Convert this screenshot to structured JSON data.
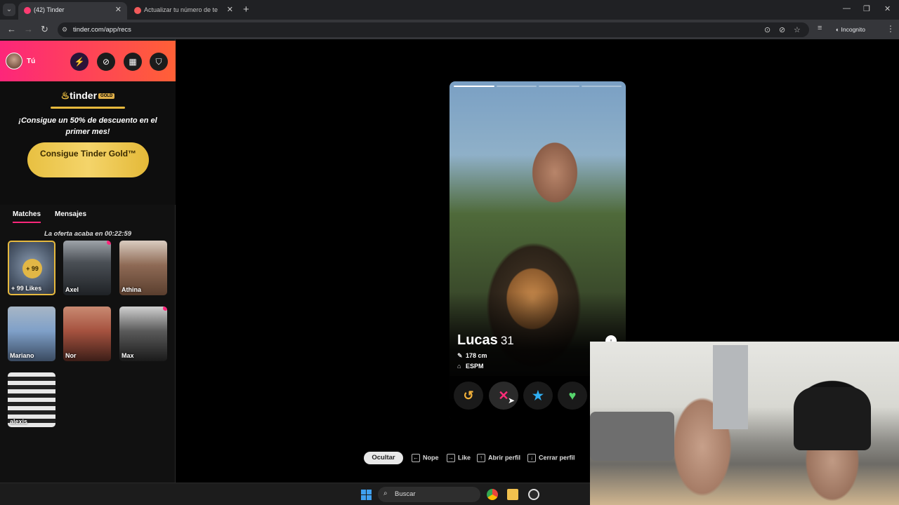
{
  "browser": {
    "tabs": [
      {
        "title": "(42) Tinder",
        "active": true
      },
      {
        "title": "Actualizar tu número de teléfono",
        "active": false
      }
    ],
    "url": "tinder.com/app/recs",
    "incognito_label": "Incognito",
    "icons": [
      "back-icon",
      "forward-icon",
      "reload-icon",
      "location-icon",
      "eye-off-icon",
      "star-icon",
      "reading-list-icon",
      "incognito-icon",
      "menu-icon"
    ]
  },
  "sidebar": {
    "user_label": "Tú",
    "header_buttons": [
      "bolt-icon",
      "explore-icon",
      "gift-icon",
      "shield-icon"
    ],
    "logo_text": "tinder",
    "logo_badge": "GOLD",
    "promo_text": "¡Consigue un 50% de descuento en el primer mes!",
    "gold_button": "Consigue Tinder Gold™",
    "timer_text": "La oferta acaba en 00:22:59",
    "tabs": {
      "matches": "Matches",
      "messages": "Mensajes"
    },
    "likes_badge": "+ 99",
    "matches": [
      {
        "name": "+ 99 Likes"
      },
      {
        "name": "Axel",
        "new": true
      },
      {
        "name": "Athina"
      },
      {
        "name": "Mariano"
      },
      {
        "name": "Nor"
      },
      {
        "name": "Max",
        "new": true
      },
      {
        "name": "alexis"
      }
    ]
  },
  "profile": {
    "name": "Lucas",
    "age": "31",
    "height": "178 cm",
    "school": "ESPM",
    "photo_count": 4,
    "photo_index": 1
  },
  "actions": {
    "rewind": "↺",
    "nope": "✕",
    "super_like": "★",
    "like": "♥"
  },
  "shortcuts": {
    "hide": "Ocultar",
    "nope": "Nope",
    "like": "Like",
    "open_profile": "Abrir perfil",
    "close_profile": "Cerrar perfil"
  },
  "taskbar": {
    "search_label": "Buscar"
  },
  "colors": {
    "brand_gradient_start": "#fd267a",
    "brand_gradient_end": "#ff6036",
    "gold": "#e8c041",
    "nope": "#fd2d79",
    "super_like": "#2fb0f5",
    "like": "#56d46c",
    "rewind": "#f2b13a"
  }
}
